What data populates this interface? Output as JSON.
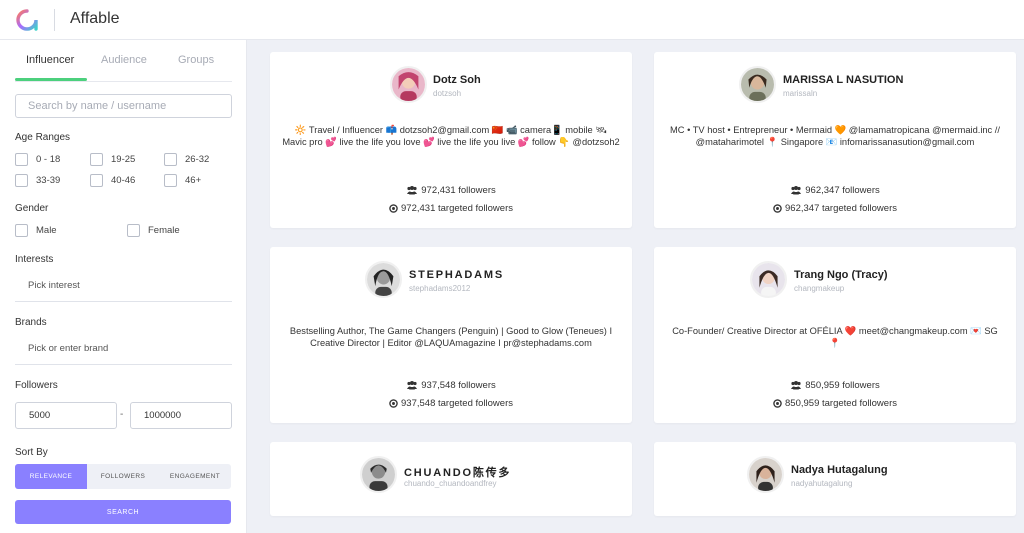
{
  "app": {
    "title": "Affable"
  },
  "sidebar": {
    "tabs": [
      {
        "label": "Influencer",
        "active": true
      },
      {
        "label": "Audience",
        "active": false
      },
      {
        "label": "Groups",
        "active": false
      }
    ],
    "search": {
      "placeholder": "Search by name / username",
      "value": ""
    },
    "age_ranges": {
      "label": "Age Ranges",
      "options": [
        "0 - 18",
        "19-25",
        "26-32",
        "33-39",
        "40-46",
        "46+"
      ]
    },
    "gender": {
      "label": "Gender",
      "options": [
        "Male",
        "Female"
      ]
    },
    "interests": {
      "label": "Interests",
      "placeholder": "Pick interest"
    },
    "brands": {
      "label": "Brands",
      "placeholder": "Pick or enter brand"
    },
    "followers": {
      "label": "Followers",
      "min": "5000",
      "max": "1000000",
      "separator": "-"
    },
    "sort_by": {
      "label": "Sort By",
      "options": [
        {
          "label": "RELEVANCE",
          "active": true
        },
        {
          "label": "FOLLOWERS",
          "active": false
        },
        {
          "label": "ENGAGEMENT",
          "active": false
        }
      ]
    },
    "search_button": "SEARCH"
  },
  "influencers": [
    {
      "name": "Dotz Soh",
      "username": "dotzsoh",
      "bio": "🔆 Travel / Influencer 📫 dotzsoh2@gmail.com 🇨🇳 📹 camera📱 mobile 🛰 Mavic pro 💕 live the life you love 💕 live the life you live 💕 follow 👇 @dotzsoh2",
      "followers": "972,431 followers",
      "targeted": "972,431 targeted followers"
    },
    {
      "name": "MARISSA L NASUTION",
      "username": "marissaln",
      "bio": "MC • TV host • Entrepreneur • Mermaid 🧡 @lamamatropicana @mermaid.inc // @mataharimotel 📍 Singapore 📧 infomarissanasution@gmail.com",
      "followers": "962,347 followers",
      "targeted": "962,347 targeted followers"
    },
    {
      "name": "STEPHADAMS",
      "username": "stephadams2012",
      "bio": "Bestselling Author, The Game Changers (Penguin) | Good to Glow (Teneues) I Creative Director | Editor @LAQUAmagazine I pr@stephadams.com",
      "followers": "937,548 followers",
      "targeted": "937,548 targeted followers"
    },
    {
      "name": "Trang Ngo (Tracy)",
      "username": "changmakeup",
      "bio": "Co-Founder/ Creative Director at OFÉLIA ❤️ meet@changmakeup.com 💌 SG 📍",
      "followers": "850,959 followers",
      "targeted": "850,959 targeted followers"
    },
    {
      "name": "CHUANDO陈传多",
      "username": "chuando_chuandoandfrey",
      "bio": "",
      "followers": "",
      "targeted": ""
    },
    {
      "name": "Nadya Hutagalung",
      "username": "nadyahutagalung",
      "bio": "",
      "followers": "",
      "targeted": ""
    }
  ],
  "colors": {
    "accent": "#8a80ff",
    "tab_underline": "#4cd07d",
    "background": "#eef0f6"
  }
}
